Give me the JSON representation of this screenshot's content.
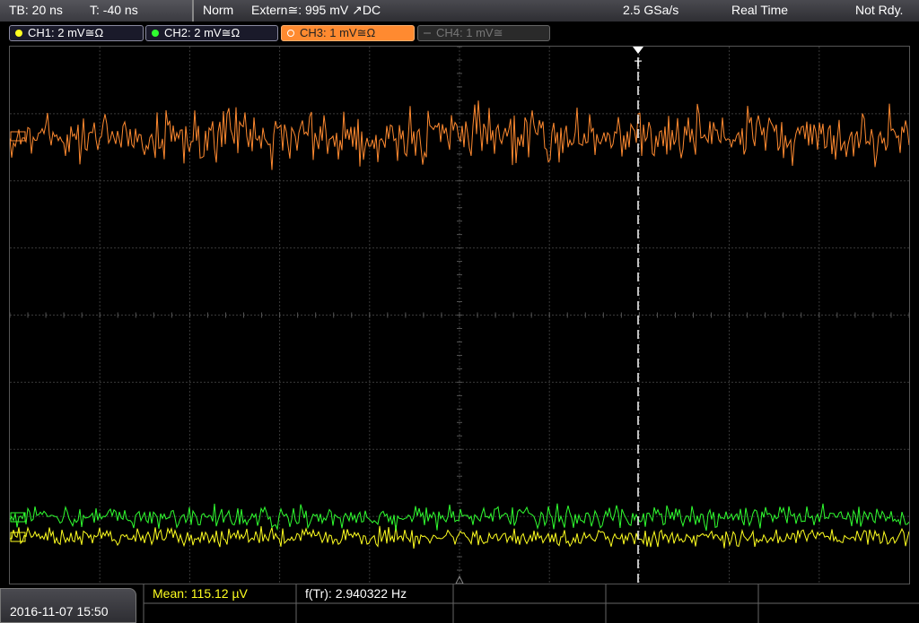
{
  "topbar": {
    "timebase": "TB: 20 ns",
    "trigger_time": "T: -40 ns",
    "mode": "Norm",
    "trigger_source": "Extern≅: 995 mV ↗DC",
    "sample_rate": "2.5 GSa/s",
    "acq_mode": "Real Time",
    "status": "Not Rdy."
  },
  "channels": [
    {
      "label": "CH1: 2 mV≅Ω",
      "color": "#ffff20",
      "active": true
    },
    {
      "label": "CH2: 2 mV≅Ω",
      "color": "#30ff30",
      "active": true
    },
    {
      "label": "CH3: 1 mV≅Ω",
      "color": "#ff8a30",
      "active": true
    },
    {
      "label": "CH4: 1 mV≅",
      "color": "#777777",
      "active": false
    }
  ],
  "measurements": {
    "mean": "Mean: 115.12 µV",
    "freq": "f(Tr): 2.940322 Hz"
  },
  "datetime": "2016-11-07 15:50",
  "colors": {
    "ch1": "#ffff20",
    "ch2": "#30ff30",
    "ch3": "#ff8a30",
    "grid": "#3a3a3a"
  }
}
